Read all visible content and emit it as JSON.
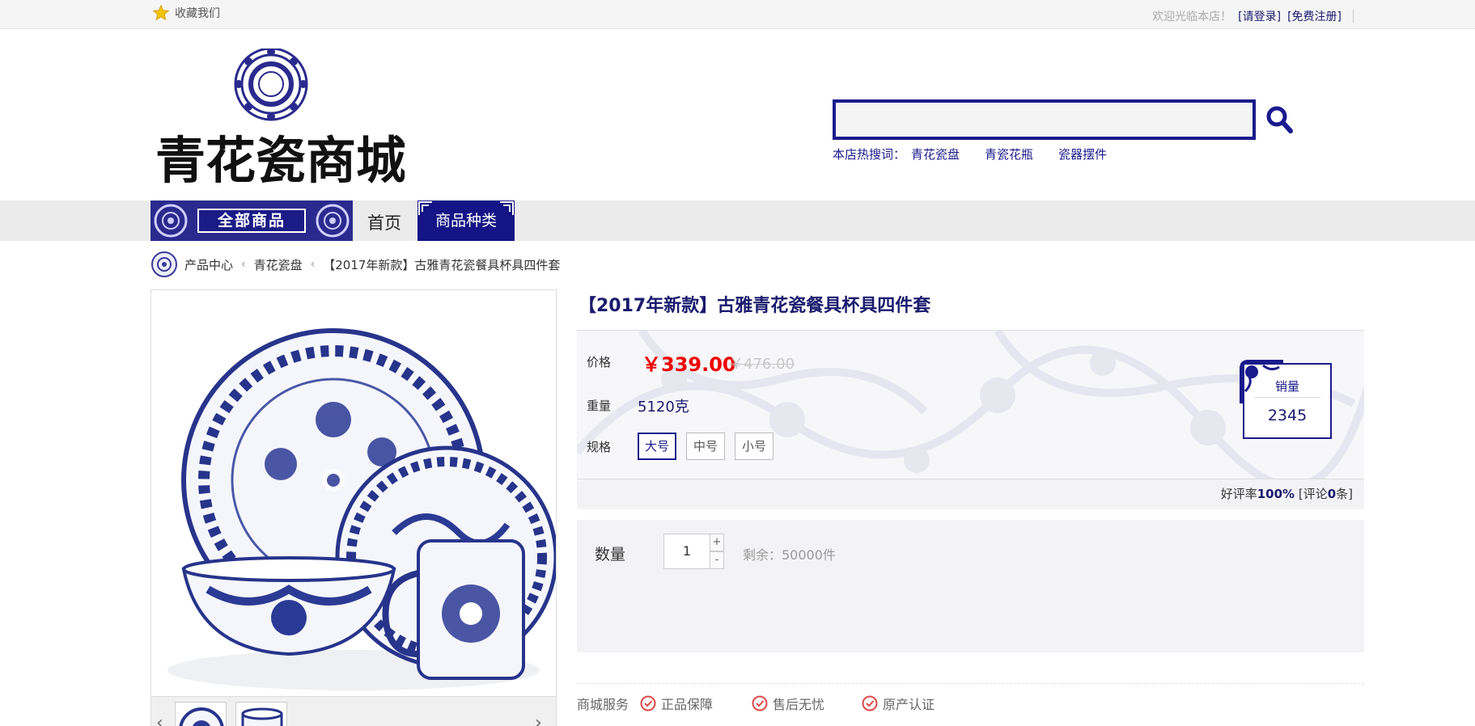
{
  "topbar": {
    "favorite": "收藏我们",
    "welcome": "欢迎光临本店！",
    "login": "[请登录]",
    "register": "[免费注册]"
  },
  "header": {
    "logo_text": "青花瓷商城",
    "search_placeholder": "",
    "hot_label": "本店热搜词：",
    "hot_words": [
      "青花瓷盘",
      "青瓷花瓶",
      "瓷器摆件"
    ]
  },
  "nav": {
    "all_goods": "全部商品",
    "home": "首页",
    "categories": "商品种类"
  },
  "breadcrumb": {
    "items": [
      "产品中心",
      "青花瓷盘",
      "【2017年新款】古雅青花瓷餐具杯具四件套"
    ]
  },
  "product": {
    "title": "【2017年新款】古雅青花瓷餐具杯具四件套",
    "price_label": "价格",
    "price": "￥339.00",
    "old_price": "￥476.00",
    "weight_label": "重量",
    "weight": "5120克",
    "spec_label": "规格",
    "specs": [
      "大号",
      "中号",
      "小号"
    ],
    "sales_label": "销量",
    "sales": "2345",
    "rating_text": "好评率",
    "rating_value": "100%",
    "review_prefix": "[评论",
    "review_count": "0",
    "review_suffix": "条]",
    "qty_label": "数量",
    "qty": "1",
    "qty_plus": "+",
    "qty_minus": "-",
    "stock": "剩余：50000件",
    "service_label": "商城服务",
    "services": [
      "正品保障",
      "售后无忧",
      "原产认证"
    ]
  },
  "colors": {
    "brand_blue": "#1a1a8c",
    "price_red": "#ee0000"
  }
}
